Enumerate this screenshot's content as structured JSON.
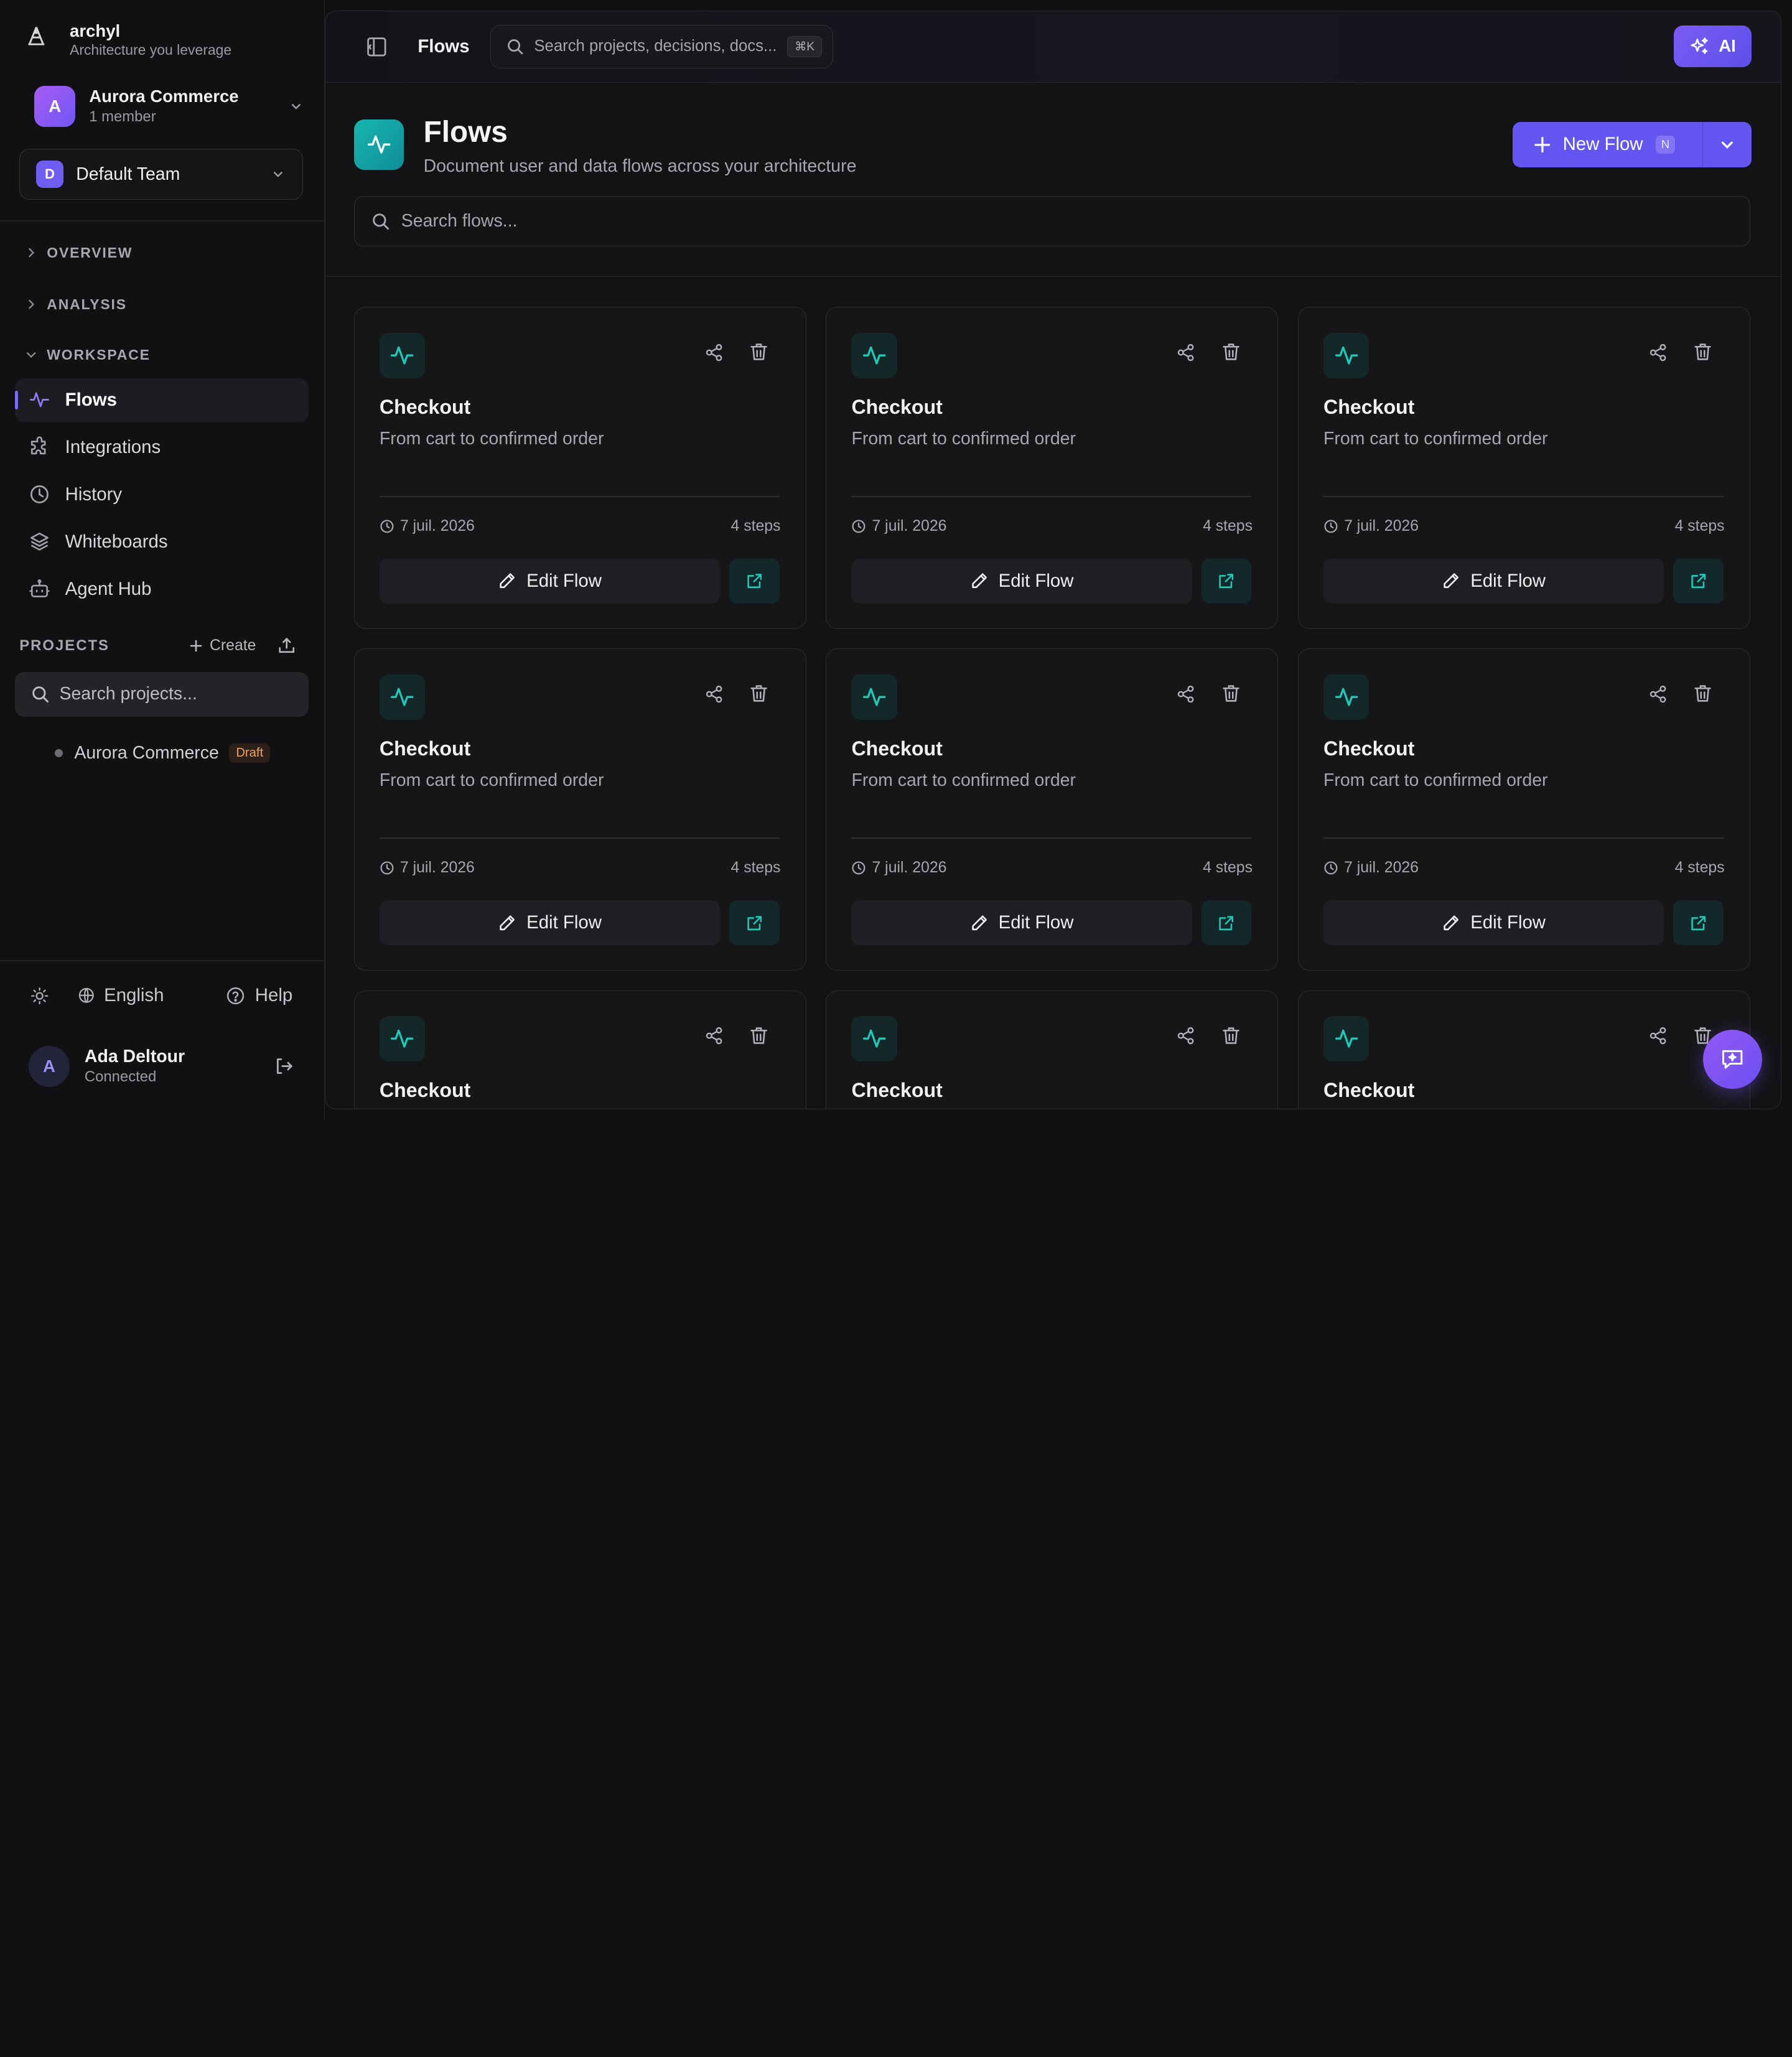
{
  "brand": {
    "name": "archyl",
    "tagline": "Architecture you leverage"
  },
  "org": {
    "name": "Aurora Commerce",
    "members": "1 member",
    "initial": "A"
  },
  "team": {
    "name": "Default Team",
    "initial": "D"
  },
  "sections": {
    "overview": "OVERVIEW",
    "analysis": "ANALYSIS",
    "workspace": "WORKSPACE"
  },
  "nav": [
    {
      "label": "Flows",
      "icon": "activity-icon",
      "active": true
    },
    {
      "label": "Integrations",
      "icon": "puzzle-icon"
    },
    {
      "label": "History",
      "icon": "clock-icon"
    },
    {
      "label": "Whiteboards",
      "icon": "layers-icon"
    },
    {
      "label": "Agent Hub",
      "icon": "bot-icon"
    }
  ],
  "projects": {
    "title": "PROJECTS",
    "create": "Create",
    "search_placeholder": "Search projects...",
    "items": [
      {
        "name": "Aurora Commerce",
        "badge": "Draft"
      }
    ]
  },
  "footer": {
    "language": "English",
    "help": "Help"
  },
  "user": {
    "name": "Ada Deltour",
    "status": "Connected",
    "initial": "A"
  },
  "topbar": {
    "title": "Flows",
    "search_placeholder": "Search projects, decisions, docs...",
    "shortcut": "⌘K",
    "ai_label": "AI"
  },
  "header": {
    "title": "Flows",
    "subtitle": "Document user and data flows across your architecture",
    "new_flow": "New Flow",
    "new_flow_kbd": "N",
    "search_placeholder": "Search flows..."
  },
  "cards": [
    {
      "title": "Checkout",
      "desc": "From cart to confirmed order",
      "date": "7 juil. 2026",
      "steps": "4 steps",
      "edit": "Edit Flow"
    },
    {
      "title": "Checkout",
      "desc": "From cart to confirmed order",
      "date": "7 juil. 2026",
      "steps": "4 steps",
      "edit": "Edit Flow"
    },
    {
      "title": "Checkout",
      "desc": "From cart to confirmed order",
      "date": "7 juil. 2026",
      "steps": "4 steps",
      "edit": "Edit Flow"
    },
    {
      "title": "Checkout",
      "desc": "From cart to confirmed order",
      "date": "7 juil. 2026",
      "steps": "4 steps",
      "edit": "Edit Flow"
    },
    {
      "title": "Checkout",
      "desc": "From cart to confirmed order",
      "date": "7 juil. 2026",
      "steps": "4 steps",
      "edit": "Edit Flow"
    },
    {
      "title": "Checkout",
      "desc": "From cart to confirmed order",
      "date": "7 juil. 2026",
      "steps": "4 steps",
      "edit": "Edit Flow"
    },
    {
      "title": "Checkout"
    },
    {
      "title": "Checkout"
    },
    {
      "title": "Checkout"
    }
  ],
  "colors": {
    "accent": "#6355ef",
    "teal": "#22c7b8",
    "draft": "#f0a35a"
  }
}
